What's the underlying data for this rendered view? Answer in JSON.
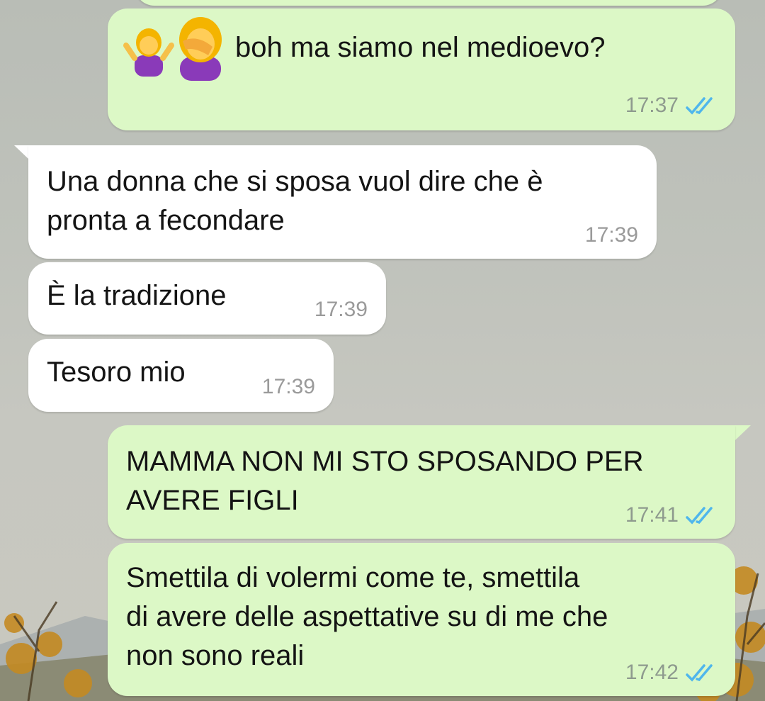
{
  "messages": [
    {
      "direction": "outgoing",
      "emojis": [
        "woman-shrugging",
        "woman-facepalming"
      ],
      "text": "boh ma siamo nel medioevo?",
      "time": "17:37",
      "status": "read"
    },
    {
      "direction": "incoming",
      "text": "Una donna che si sposa vuol dire che è\npronta a fecondare",
      "time": "17:39"
    },
    {
      "direction": "incoming",
      "text": "È la tradizione",
      "time": "17:39"
    },
    {
      "direction": "incoming",
      "text": "Tesoro mio",
      "time": "17:39"
    },
    {
      "direction": "outgoing",
      "text": "MAMMA NON MI STO SPOSANDO PER\nAVERE FIGLI",
      "time": "17:41",
      "status": "read"
    },
    {
      "direction": "outgoing",
      "text": "Smettila di volermi come te, smettila\ndi avere delle aspettative su di me che\nnon sono reali",
      "time": "17:42",
      "status": "read"
    }
  ],
  "colors": {
    "outgoing_bubble": "#dcf8c6",
    "incoming_bubble": "#ffffff",
    "read_ticks": "#4fb6ec"
  }
}
